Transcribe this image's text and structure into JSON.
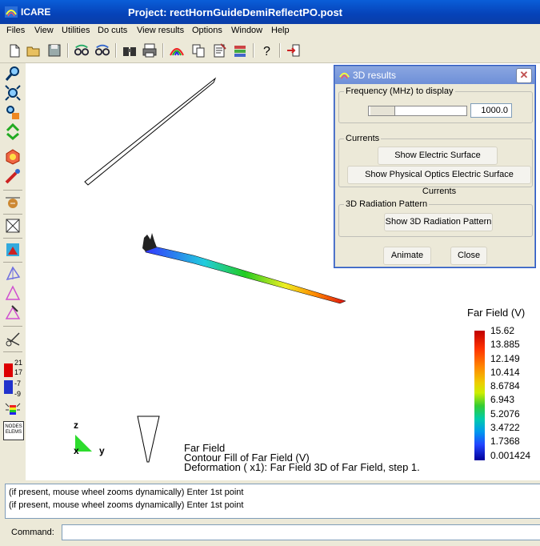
{
  "app": {
    "name": "ICARE",
    "project_title": "Project: rectHornGuideDemiReflectPO.post"
  },
  "menu": [
    "Files",
    "View",
    "Utilities",
    "Do cuts",
    "View results",
    "Options",
    "Window",
    "Help"
  ],
  "toolbar_icons": [
    "new-file-icon",
    "open-folder-icon",
    "save-disk-icon",
    "eye-icon",
    "eye-alt-icon",
    "binoculars-icon",
    "print-icon",
    "rainbow-icon",
    "copy-icon",
    "notes-icon",
    "layers-icon",
    "help-icon",
    "exit-icon"
  ],
  "left_toolbar_icons": [
    "zoom-icon",
    "zoom-window-icon",
    "zoom-extents-icon",
    "graph-icon",
    "zoom-region-icon",
    "colors-icon",
    "rotate-icon",
    "light-icon",
    "pick-icon",
    "rendering-icon",
    "box-icon",
    "color-layer-icon",
    "triangle-icon",
    "triangle-alt-icon",
    "mesh-tool-icon",
    "cut-icon",
    "color-scale-icon",
    "color-scale-alt-icon",
    "rainbow-light-icon",
    "nodes-elems-icon"
  ],
  "left_scale_labels": [
    "21",
    "17",
    "-7",
    "-9"
  ],
  "nodes_elems_text": [
    "NODES",
    "ELEMS"
  ],
  "dialog": {
    "title": "3D results",
    "frequency_group_label": "Frequency (MHz) to display",
    "frequency_value": "1000.0",
    "currents_group_label": "Currents",
    "show_electric_currents": "Show Electric Surface Currents",
    "show_po_currents": "Show Physical Optics Electric Surface Currents",
    "radiation_group_label": "3D Radiation Pattern",
    "show_radiation": "Show 3D Radiation Pattern",
    "animate": "Animate",
    "close": "Close"
  },
  "colorbar": {
    "title": "Far Field (V)",
    "labels": [
      "15.62",
      "13.885",
      "12.149",
      "10.414",
      "8.6784",
      "6.943",
      "5.2076",
      "3.4722",
      "1.7368",
      "0.001424"
    ]
  },
  "axes": {
    "z": "z",
    "x": "x",
    "y": "y"
  },
  "caption": {
    "line1": "Far Field",
    "line2": "Contour Fill of Far Field (V)",
    "line3": "Deformation ( x1): Far Field 3D of Far Field, step 1."
  },
  "messages": [
    "(if present, mouse wheel zooms dynamically) Enter 1st point",
    "(if present, mouse wheel zooms dynamically) Enter 1st point"
  ],
  "command": {
    "label": "Command:",
    "value": ""
  },
  "colors": {
    "title_bar": "#0a5ed8",
    "window_bg": "#ece9d8",
    "canvas_bg": "#ffffff"
  }
}
